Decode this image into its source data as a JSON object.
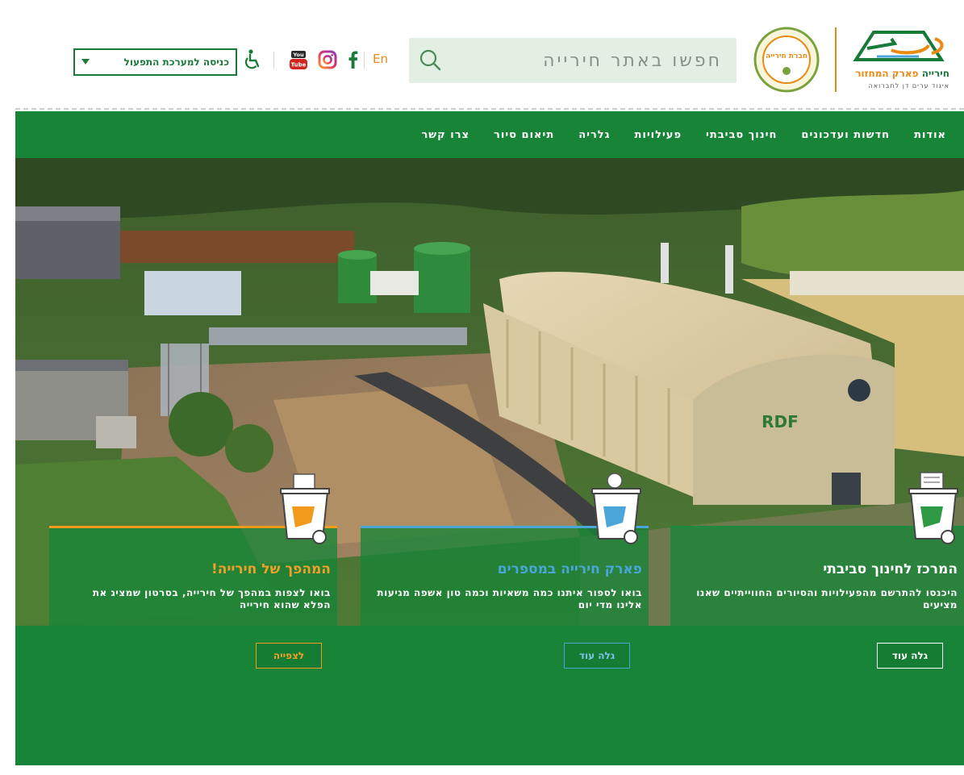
{
  "header": {
    "logo": {
      "name_main": "חירייה",
      "name_accent": "פארק המחזור",
      "tagline": "איגוד ערים דן לתברואה"
    },
    "badge_text": "חברת חירייה",
    "search": {
      "placeholder": "חפשו באתר חירייה"
    },
    "language_label": "En",
    "login_select_label": "כניסה למערכת התפעול"
  },
  "nav": {
    "items": [
      {
        "label": "אודות"
      },
      {
        "label": "חדשות ועדכונים"
      },
      {
        "label": "חינוך סביבתי"
      },
      {
        "label": "פעילויות"
      },
      {
        "label": "גלריה"
      },
      {
        "label": "תיאום סיור"
      },
      {
        "label": "צרו קשר"
      }
    ]
  },
  "hero": {
    "sign_text": "RDF"
  },
  "cards": [
    {
      "title": "המרכז לחינוך סביבתי",
      "text": "היכנסו להתרשם מהפעילויות והסיורים החווייתיים שאנו מציעים",
      "button": "גלה עוד",
      "accent_color": "#1f8a3f"
    },
    {
      "title": "פארק חירייה במספרים",
      "text": "בואו לספור איתנו כמה משאיות וכמה טון אשפה מגיעות אלינו מדי יום",
      "button": "גלה עוד",
      "accent_color": "#4aa6d8"
    },
    {
      "title": "המהפך של חירייה!",
      "text": "בואו לצפות במהפך של חירייה, בסרטון שמציג את הפלא שהוא חירייה",
      "button": "לצפייה",
      "accent_color": "#f29a1c"
    }
  ],
  "colors": {
    "brand_green": "#178437",
    "accent_orange": "#e98a13",
    "search_bg": "#e3efe3"
  },
  "icons": [
    "search-icon",
    "youtube-icon",
    "instagram-icon",
    "facebook-icon",
    "accessibility-icon",
    "chevron-down-icon",
    "recycle-bin-icon"
  ]
}
